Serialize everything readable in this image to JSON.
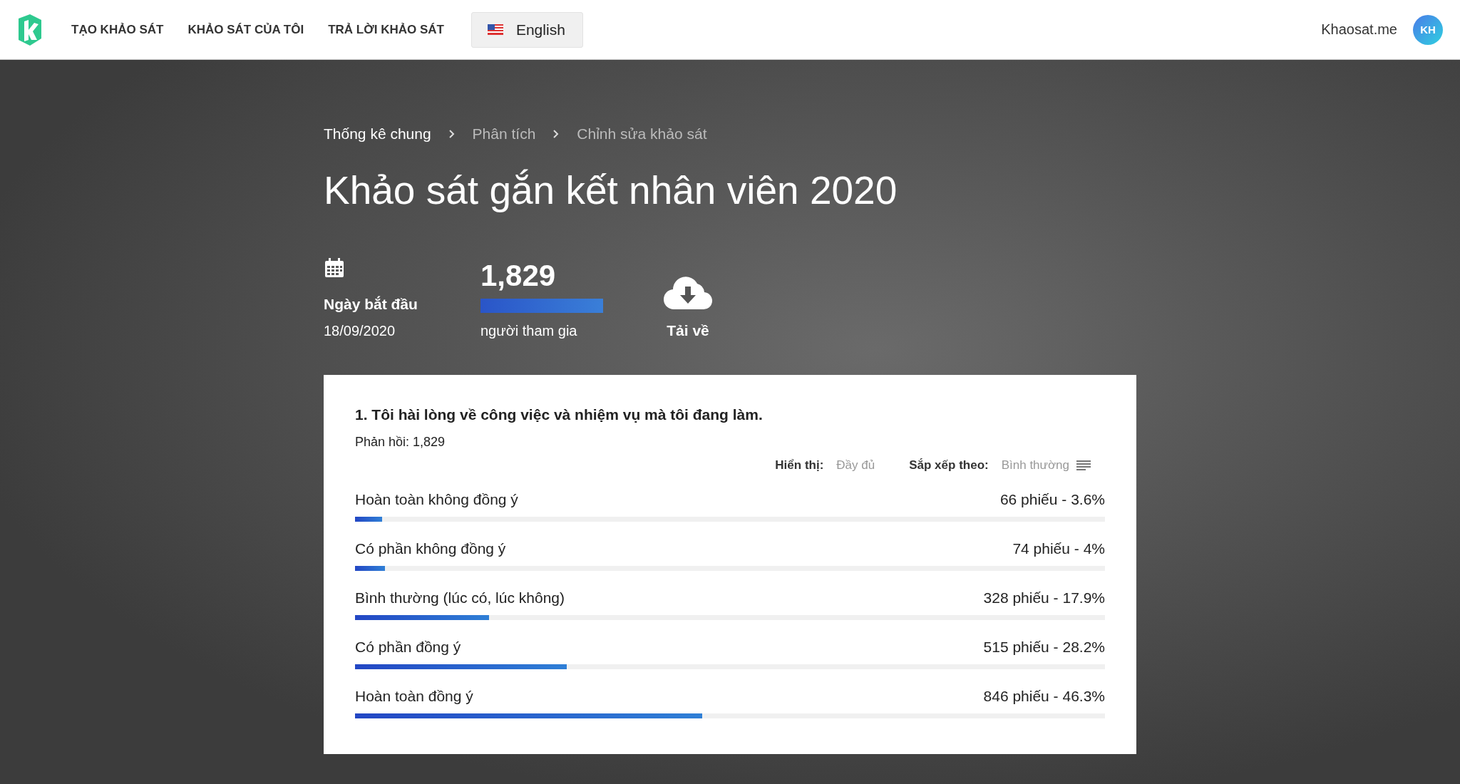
{
  "nav": {
    "links": [
      {
        "label": "TẠO KHẢO SÁT"
      },
      {
        "label": "KHẢO SÁT CỦA TÔI"
      },
      {
        "label": "TRẢ LỜI KHẢO SÁT"
      }
    ],
    "language": "English",
    "site": "Khaosat.me",
    "avatar": "KH"
  },
  "breadcrumb": [
    {
      "label": "Thống kê chung",
      "active": true
    },
    {
      "label": "Phân tích",
      "active": false
    },
    {
      "label": "Chỉnh sửa khảo sát",
      "active": false
    }
  ],
  "title": "Khảo sát gắn kết nhân viên 2020",
  "stats": {
    "start_label": "Ngày bắt đầu",
    "start_date": "18/09/2020",
    "participants": "1,829",
    "participants_label": "người tham gia",
    "level": 1,
    "download_label": "Tải về"
  },
  "question": {
    "title": "1. Tôi hài lòng về công việc và nhiệm vụ mà tôi đang làm.",
    "responses": "Phản hồi: 1,829",
    "display_label": "Hiển thị:",
    "display_value": "Đầy đủ",
    "sort_label": "Sắp xếp theo:",
    "sort_value": "Bình thường",
    "options": [
      {
        "label": "Hoàn toàn không đồng ý",
        "count": "66 phiếu - 3.6%",
        "level": 0.036
      },
      {
        "label": "Có phần không đồng ý",
        "count": "74 phiếu - 4%",
        "level": 0.04
      },
      {
        "label": "Bình thường (lúc có, lúc không)",
        "count": "328 phiếu - 17.9%",
        "level": 0.179
      },
      {
        "label": "Có phần đồng ý",
        "count": "515 phiếu - 28.2%",
        "level": 0.282
      },
      {
        "label": "Hoàn toàn đồng ý",
        "count": "846 phiếu - 46.3%",
        "level": 0.463
      }
    ]
  }
}
